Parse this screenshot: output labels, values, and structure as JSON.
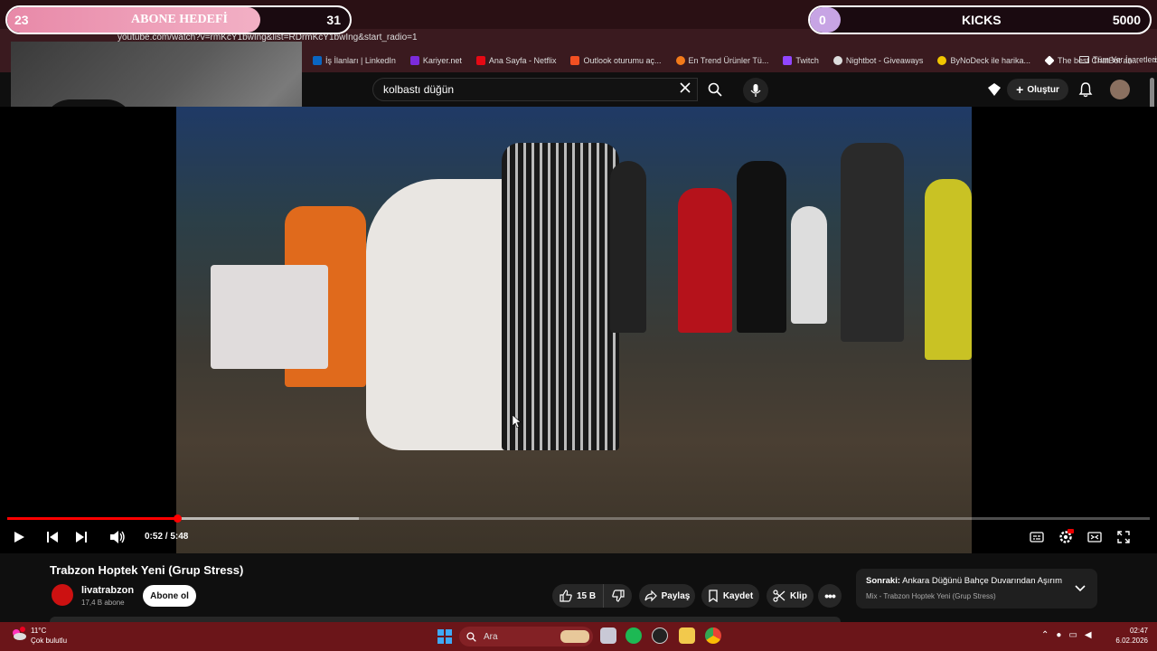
{
  "browser": {
    "url": "youtube.com/watch?v=rmKcY1bwIng&list=RDrmKcY1bwIng&start_radio=1",
    "bookmarks": [
      {
        "label": "İş İlanları | LinkedIn",
        "color": "#0a66c2"
      },
      {
        "label": "Kariyer.net",
        "color": "#7b2bdb"
      },
      {
        "label": "Ana Sayfa - Netflix",
        "color": "#e50914"
      },
      {
        "label": "Outlook oturumu aç...",
        "color": "#f25022"
      },
      {
        "label": "En Trend Ürünler Tü...",
        "color": "#f27a1a"
      },
      {
        "label": "Twitch",
        "color": "#9146ff"
      },
      {
        "label": "Nightbot - Giveaways",
        "color": "#dddddd"
      },
      {
        "label": "ByNoDeck ile harika...",
        "color": "#f2c600"
      },
      {
        "label": "The best ChatBot an...",
        "color": "#ffffff"
      }
    ],
    "more_bookmarks": "»",
    "all_bookmarks": "Tüm Yer İşaretleri"
  },
  "overlay": {
    "abone_goal": {
      "current": "23",
      "title": "ABONE HEDEFİ",
      "target": "31",
      "progress": 0.74,
      "color": "#e889a8"
    },
    "kicks_goal": {
      "current": "0",
      "title": "KICKS",
      "target": "5000",
      "progress": 0.0,
      "color": "#c7a4e4"
    }
  },
  "youtube": {
    "search_value": "kolbastı düğün",
    "create_label": "Oluştur",
    "player": {
      "time": "0:52 / 5:48",
      "progress": 0.149,
      "buffered": 0.308
    },
    "video_title": "Trabzon Hoptek Yeni (Grup Stress)",
    "channel": {
      "name": "livatrabzon",
      "subscribers": "17,4 B abone",
      "subscribe_label": "Abone ol"
    },
    "actions": {
      "likes": "15 B",
      "share": "Paylaş",
      "save": "Kaydet",
      "clip": "Klip"
    },
    "next_up": {
      "label": "Sonraki:",
      "title": "Ankara Düğünü Bahçe Duvarından Aşırım",
      "playlist": "Mix - Trabzon Hoptek Yeni (Grup Stress)"
    }
  },
  "taskbar": {
    "weather_temp": "11°C",
    "weather_desc": "Çok bulutlu",
    "search_label": "Ara",
    "time": "02:47",
    "date": "6.02.2026"
  }
}
